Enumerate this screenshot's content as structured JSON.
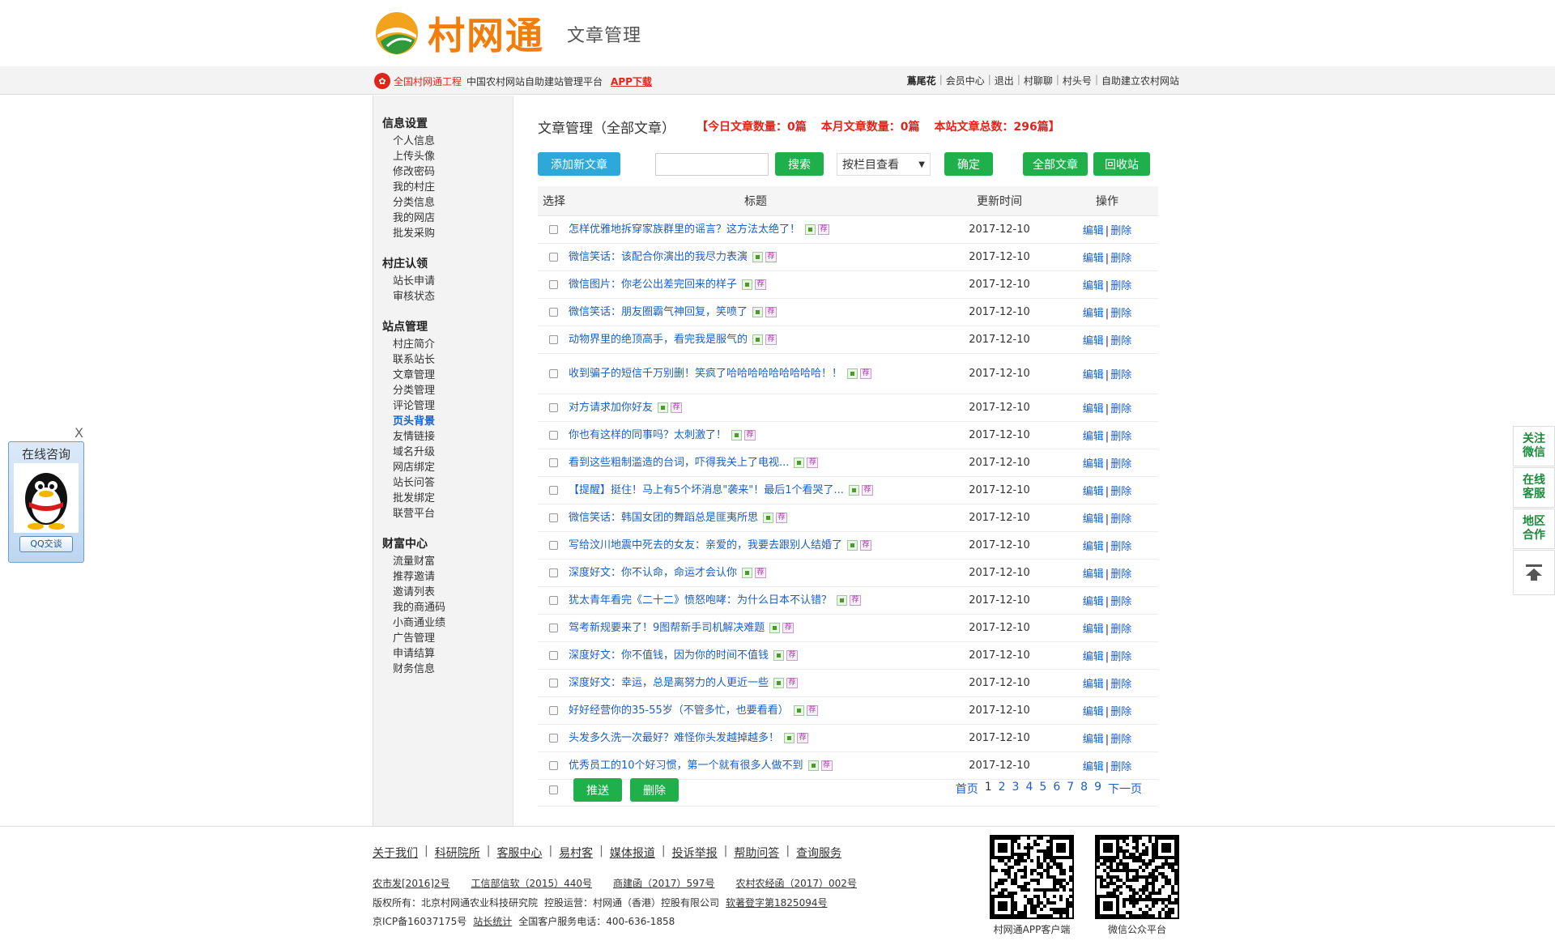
{
  "header": {
    "brand": "村网通",
    "title": "文章管理"
  },
  "topbar": {
    "project": "全国村网通工程",
    "platform": "中国农村网站自助建站管理平台",
    "app_download": "APP下载",
    "user": "蔦尾花",
    "links": [
      "会员中心",
      "退出",
      "村聊聊",
      "村头号",
      "自助建立农村网站"
    ]
  },
  "sidebar": {
    "groups": [
      {
        "title": "信息设置",
        "items": [
          "个人信息",
          "上传头像",
          "修改密码",
          "我的村庄",
          "分类信息",
          "我的网店",
          "批发采购"
        ]
      },
      {
        "title": "村庄认领",
        "items": [
          "站长申请",
          "审核状态"
        ]
      },
      {
        "title": "站点管理",
        "items": [
          "村庄简介",
          "联系站长",
          "文章管理",
          "分类管理",
          "评论管理",
          "页头背景",
          "友情链接",
          "域名升级",
          "网店绑定",
          "站长问答",
          "批发绑定",
          "联营平台"
        ]
      },
      {
        "title": "财富中心",
        "items": [
          "流量财富",
          "推荐邀请",
          "邀请列表",
          "我的商通码",
          "小商通业绩",
          "广告管理",
          "申请结算",
          "财务信息"
        ]
      }
    ],
    "active_item": "页头背景"
  },
  "main": {
    "title": "文章管理（全部文章）",
    "stat_today": "【今日文章数量：0篇",
    "stat_month": "本月文章数量：0篇",
    "stat_total": "本站文章总数：296篇】"
  },
  "toolbar": {
    "add_label": "添加新文章",
    "search_label": "搜索",
    "search_value": "",
    "select_value": "按栏目查看",
    "confirm_label": "确定",
    "all_label": "全部文章",
    "recycle_label": "回收站"
  },
  "table": {
    "headers": {
      "select": "选择",
      "title": "标题",
      "time": "更新时间",
      "op": "操作"
    },
    "edit_label": "编辑",
    "delete_label": "删除",
    "rec_tag": "荐",
    "rows": [
      {
        "title": "怎样优雅地拆穿家族群里的谣言？这方法太绝了！",
        "time": "2017-12-10"
      },
      {
        "title": "微信笑话：该配合你演出的我尽力表演",
        "time": "2017-12-10"
      },
      {
        "title": "微信图片：你老公出差完回来的样子",
        "time": "2017-12-10"
      },
      {
        "title": "微信笑话：朋友圈霸气神回复，笑喷了",
        "time": "2017-12-10"
      },
      {
        "title": "动物界里的绝顶高手，看完我是服气的",
        "time": "2017-12-10"
      },
      {
        "title": "收到骗子的短信千万别删！笑疯了哈哈哈哈哈哈哈哈哈！！",
        "time": "2017-12-10"
      },
      {
        "title": "对方请求加你好友",
        "time": "2017-12-10"
      },
      {
        "title": "你也有这样的同事吗？太刺激了！",
        "time": "2017-12-10"
      },
      {
        "title": "看到这些粗制滥造的台词，吓得我关上了电视...",
        "time": "2017-12-10"
      },
      {
        "title": "【提醒】挺住！马上有5个坏消息\"袭来\"！最后1个看哭了...",
        "time": "2017-12-10"
      },
      {
        "title": "微信笑话：韩国女团的舞蹈总是匪夷所思",
        "time": "2017-12-10"
      },
      {
        "title": "写给汶川地震中死去的女友：亲爱的，我要去跟别人结婚了",
        "time": "2017-12-10"
      },
      {
        "title": "深度好文：你不认命，命运才会认你",
        "time": "2017-12-10"
      },
      {
        "title": "犹太青年看完《二十二》愤怒咆哮：为什么日本不认错？",
        "time": "2017-12-10"
      },
      {
        "title": "驾考新规要来了！9图帮新手司机解决难题",
        "time": "2017-12-10"
      },
      {
        "title": "深度好文：你不值钱，因为你的时间不值钱",
        "time": "2017-12-10"
      },
      {
        "title": "深度好文：幸运，总是离努力的人更近一些",
        "time": "2017-12-10"
      },
      {
        "title": "好好经营你的35-55岁（不管多忙，也要看看）",
        "time": "2017-12-10"
      },
      {
        "title": "头发多久洗一次最好？难怪你头发越掉越多！",
        "time": "2017-12-10"
      },
      {
        "title": "优秀员工的10个好习惯，第一个就有很多人做不到",
        "time": "2017-12-10"
      }
    ],
    "push_label": "推送",
    "bulk_delete_label": "删除"
  },
  "pager": {
    "first": "首页",
    "pages": [
      "1",
      "2",
      "3",
      "4",
      "5",
      "6",
      "7",
      "8",
      "9"
    ],
    "current": "1",
    "next": "下一页"
  },
  "footer": {
    "links": [
      "关于我们",
      "科研院所",
      "客服中心",
      "易村客",
      "媒体报道",
      "投诉举报",
      "帮助问答",
      "查询服务"
    ],
    "regs": [
      "农市发[2016]2号",
      "工信部信软（2015）440号",
      "商建函（2017）597号",
      "农村农经函（2017）002号"
    ],
    "copyright": "版权所有：北京村网通农业科技研究院",
    "holder": "控股运营：村网通（香港）控股有限公司",
    "soft": "软著登字第1825094号",
    "icp": "京ICP备16037175号",
    "stats": "站长统计",
    "hotline": "全国客户服务电话：400-636-1858",
    "qr_app": "村网通APP客户端",
    "qr_wechat": "微信公众平台"
  },
  "qq": {
    "title": "在线咨询",
    "button": "QQ交谈",
    "close": "X"
  },
  "side_float": {
    "items": [
      "关注\n微信",
      "在线\n客服",
      "地区\n合作"
    ]
  },
  "colors": {
    "brand_orange": "#f07d0c",
    "green": "#1fb04c",
    "blue": "#2da8d8",
    "red": "#e2231a",
    "link": "#1b5fc4"
  }
}
